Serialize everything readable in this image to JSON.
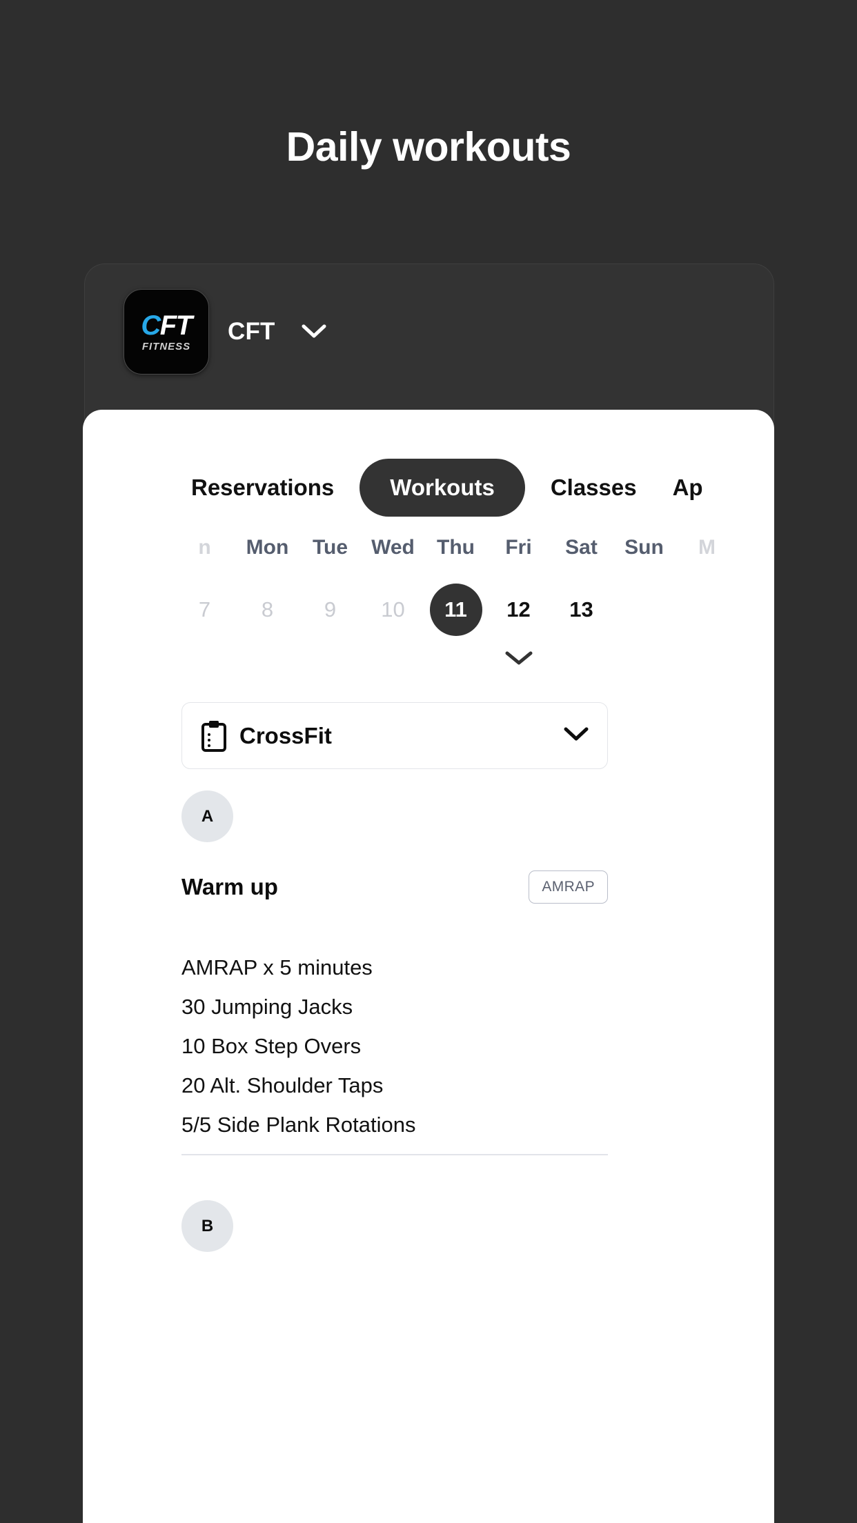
{
  "page": {
    "title": "Daily workouts",
    "background_color": "#2e2e2e"
  },
  "app_header": {
    "brand_name": "CFT",
    "logo": {
      "mark_primary": "C",
      "mark_secondary": "FT",
      "sub_text": "FITNESS",
      "primary_color": "#27a8e8",
      "secondary_color": "#ffffff"
    },
    "caret_icon": "chevron-down-icon"
  },
  "tabs": [
    {
      "label": "Reservations",
      "active": false
    },
    {
      "label": "Workouts",
      "active": true
    },
    {
      "label": "Classes",
      "active": false
    },
    {
      "label": "Ap",
      "active": false
    }
  ],
  "calendar": {
    "daynames": [
      "n",
      "Mon",
      "Tue",
      "Wed",
      "Thu",
      "Fri",
      "Sat",
      "Sun",
      "M"
    ],
    "dates": [
      {
        "num": "7",
        "state": "past"
      },
      {
        "num": "8",
        "state": "past"
      },
      {
        "num": "9",
        "state": "past"
      },
      {
        "num": "10",
        "state": "past"
      },
      {
        "num": "11",
        "state": "selected"
      },
      {
        "num": "12",
        "state": "normal"
      },
      {
        "num": "13",
        "state": "normal"
      },
      {
        "num": "",
        "state": "edge"
      }
    ],
    "expand_icon": "chevron-down-icon",
    "selected_color": "#333333"
  },
  "program_select": {
    "icon": "clipboard-icon",
    "label": "CrossFit",
    "caret_icon": "chevron-down-icon"
  },
  "workout_blocks": [
    {
      "letter": "A",
      "title": "Warm up",
      "badge": "AMRAP",
      "lines": [
        "AMRAP x 5 minutes",
        "30 Jumping Jacks",
        "10 Box Step Overs",
        "20 Alt. Shoulder Taps",
        "5/5 Side Plank Rotations"
      ]
    },
    {
      "letter": "B",
      "title": "",
      "badge": "",
      "lines": []
    }
  ]
}
